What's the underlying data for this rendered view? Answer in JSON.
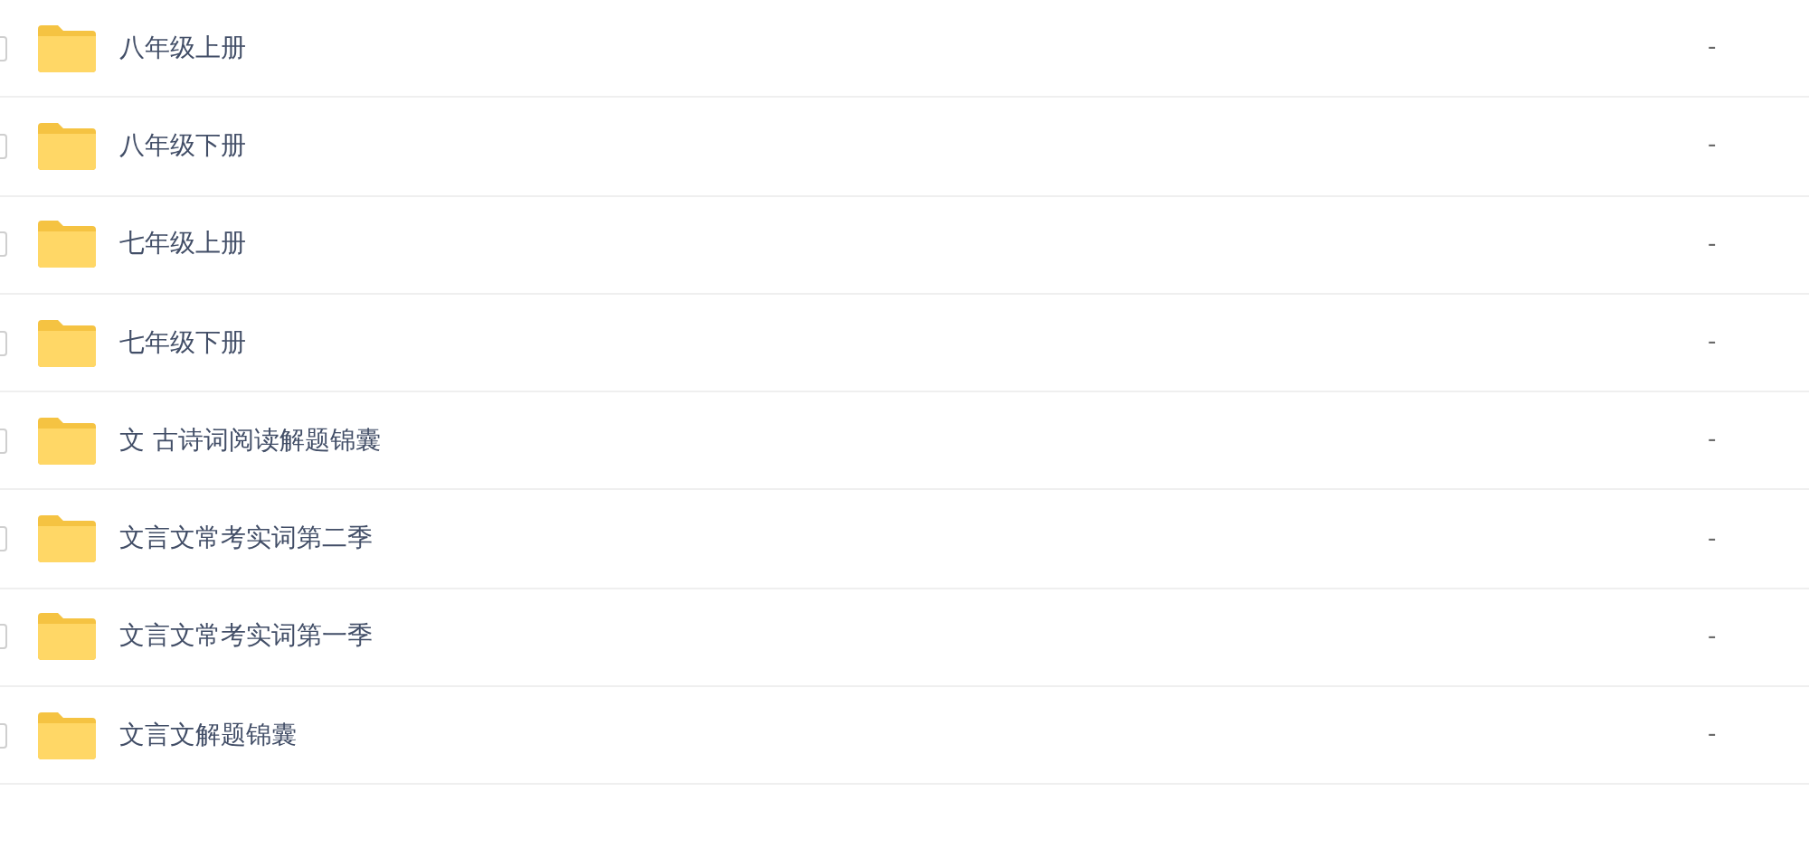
{
  "files": [
    {
      "name": "八年级上册",
      "size": "-",
      "checked": false
    },
    {
      "name": "八年级下册",
      "size": "-",
      "checked": false
    },
    {
      "name": "七年级上册",
      "size": "-",
      "checked": false
    },
    {
      "name": "七年级下册",
      "size": "-",
      "checked": false
    },
    {
      "name": "文 古诗词阅读解题锦囊",
      "size": "-",
      "checked": false
    },
    {
      "name": "文言文常考实词第二季",
      "size": "-",
      "checked": false
    },
    {
      "name": "文言文常考实词第一季",
      "size": "-",
      "checked": false
    },
    {
      "name": "文言文解题锦囊",
      "size": "-",
      "checked": false
    }
  ]
}
